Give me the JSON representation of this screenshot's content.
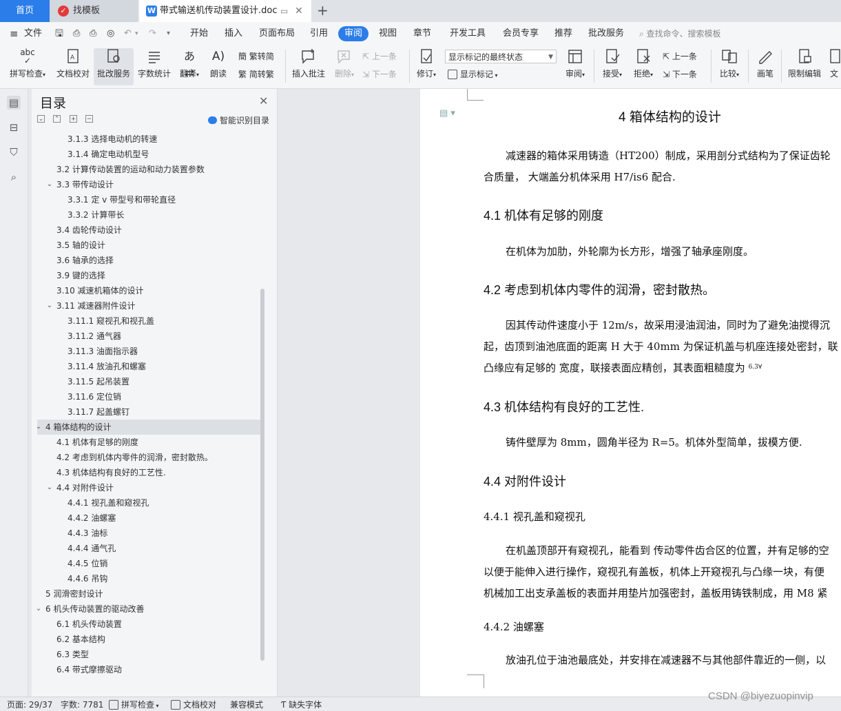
{
  "titlebar": {
    "tabs": [
      {
        "label": "首页"
      },
      {
        "label": "找模板"
      },
      {
        "label": "带式输送机传动装置设计.doc"
      }
    ]
  },
  "menu": {
    "file": "文件",
    "items": [
      "开始",
      "插入",
      "页面布局",
      "引用",
      "审阅",
      "视图",
      "章节",
      "开发工具",
      "会员专享",
      "推荐",
      "批改服务"
    ],
    "search_placeholder": "查找命令、搜索模板"
  },
  "ribbon": {
    "spell_check": "拼写检查",
    "doc_check": "文档校对",
    "correction_service": "批改服务",
    "word_count": "字数统计",
    "translate": "翻译",
    "read_aloud": "朗读",
    "trad_to_simp": "繁转简",
    "simp_to_trad": "简转繁",
    "insert_comment": "插入批注",
    "delete": "删除",
    "prev": "上一条",
    "next": "下一条",
    "track_changes": "修订",
    "markup_state": "显示标记的最终状态",
    "show_markup": "显示标记",
    "review": "审阅",
    "accept": "接受",
    "reject": "拒绝",
    "prev2": "上一条",
    "next2": "下一条",
    "compare": "比较",
    "pen": "画笔",
    "restrict_edit": "限制编辑",
    "doc_rights": "文"
  },
  "nav": {
    "title": "目录",
    "smart_toc": "智能识别目录",
    "items": [
      {
        "label": "3.1.3 选择电动机的转速",
        "level": 3,
        "chev": ""
      },
      {
        "label": "3.1.4 确定电动机型号",
        "level": 3,
        "chev": ""
      },
      {
        "label": "3.2 计算传动装置的运动和动力装置参数",
        "level": 2,
        "chev": ""
      },
      {
        "label": "3.3 带传动设计",
        "level": 2,
        "chev": "v"
      },
      {
        "label": "3.3.1 定 v 带型号和带轮直径",
        "level": 3,
        "chev": ""
      },
      {
        "label": "3.3.2 计算带长",
        "level": 3,
        "chev": ""
      },
      {
        "label": "3.4 齿轮传动设计",
        "level": 2,
        "chev": ""
      },
      {
        "label": "3.5 轴的设计",
        "level": 2,
        "chev": ""
      },
      {
        "label": "3.6 轴承的选择",
        "level": 2,
        "chev": ""
      },
      {
        "label": "3.9 键的选择",
        "level": 2,
        "chev": ""
      },
      {
        "label": "3.10 减速机箱体的设计",
        "level": 2,
        "chev": ""
      },
      {
        "label": "3.11 减速器附件设计",
        "level": 2,
        "chev": "v"
      },
      {
        "label": "3.11.1 窥视孔和视孔盖",
        "level": 3,
        "chev": ""
      },
      {
        "label": "3.11.2 通气器",
        "level": 3,
        "chev": ""
      },
      {
        "label": "3.11.3 油面指示器",
        "level": 3,
        "chev": ""
      },
      {
        "label": "3.11.4 放油孔和螺塞",
        "level": 3,
        "chev": ""
      },
      {
        "label": "3.11.5 起吊装置",
        "level": 3,
        "chev": ""
      },
      {
        "label": "3.11.6 定位销",
        "level": 3,
        "chev": ""
      },
      {
        "label": "3.11.7 起盖螺钉",
        "level": 3,
        "chev": ""
      },
      {
        "label": "4 箱体结构的设计",
        "level": 1,
        "chev": "v",
        "selected": true
      },
      {
        "label": "4.1  机体有足够的刚度",
        "level": 2,
        "chev": ""
      },
      {
        "label": "4.2 考虑到机体内零件的润滑，密封散热。",
        "level": 2,
        "chev": ""
      },
      {
        "label": "4.3 机体结构有良好的工艺性.",
        "level": 2,
        "chev": ""
      },
      {
        "label": "4.4 对附件设计",
        "level": 2,
        "chev": "v"
      },
      {
        "label": "4.4.1 视孔盖和窥视孔",
        "level": 3,
        "chev": ""
      },
      {
        "label": "4.4.2  油螺塞",
        "level": 3,
        "chev": ""
      },
      {
        "label": "4.4.3 油标",
        "level": 3,
        "chev": ""
      },
      {
        "label": "4.4.4  通气孔",
        "level": 3,
        "chev": ""
      },
      {
        "label": "4.4.5 位销",
        "level": 3,
        "chev": ""
      },
      {
        "label": "4.4.6  吊钩",
        "level": 3,
        "chev": ""
      },
      {
        "label": "5  润滑密封设计",
        "level": 1,
        "chev": ""
      },
      {
        "label": "6 机头传动装置的驱动改善",
        "level": 1,
        "chev": "v"
      },
      {
        "label": "6.1 机头传动装置",
        "level": 2,
        "chev": ""
      },
      {
        "label": "6.2 基本结构",
        "level": 2,
        "chev": ""
      },
      {
        "label": "6.3 类型",
        "level": 2,
        "chev": ""
      },
      {
        "label": "6.4 带式摩擦驱动",
        "level": 2,
        "chev": ""
      }
    ]
  },
  "document": {
    "h1": "4 箱体结构的设计",
    "p1a": "减速器的箱体采用铸造（HT200）制成，采用剖分式结构为了保证齿轮",
    "p1b": "合质量，  大端盖分机体采用 H7/is6 配合.",
    "h41": "4.1  机体有足够的刚度",
    "p2": "在机体为加肋，外轮廓为长方形，增强了轴承座刚度。",
    "h42": "4.2 考虑到机体内零件的润滑，密封散热。",
    "p3a": "因其传动件速度小于 12m/s，故采用浸油润油，同时为了避免油搅得沉",
    "p3b": "起，齿顶到油池底面的距离 H 大于 40mm  为保证机盖与机座连接处密封，联",
    "p3c": "凸缘应有足够的      宽度，联接表面应精创，其表面粗糙度为",
    "p3c_sym": "6.3∀",
    "h43": "4.3 机体结构有良好的工艺性.",
    "p4": "铸件壁厚为 8mm，圆角半径为 R=5。机体外型简单，拔模方便.",
    "h44": "4.4 对附件设计",
    "h441": "4.4.1 视孔盖和窥视孔",
    "p5a": "在机盖顶部开有窥视孔，能看到  传动零件齿合区的位置，并有足够的空",
    "p5b": "以便于能伸入进行操作，窥视孔有盖板，机体上开窥视孔与凸缘一块，有便",
    "p5c": "机械加工出支承盖板的表面并用垫片加强密封，盖板用铸铁制成，用 M8 紧",
    "h442": "4.4.2  油螺塞",
    "p6": "放油孔位于油池最底处，并安排在减速器不与其他部件靠近的一侧，以"
  },
  "status": {
    "page": "页面: 29/37",
    "words": "字数: 7781",
    "spell": "拼写检查",
    "proof": "文档校对",
    "compat": "兼容模式",
    "missing_font": "缺失字体"
  },
  "watermark": "CSDN @biyezuopinvip"
}
